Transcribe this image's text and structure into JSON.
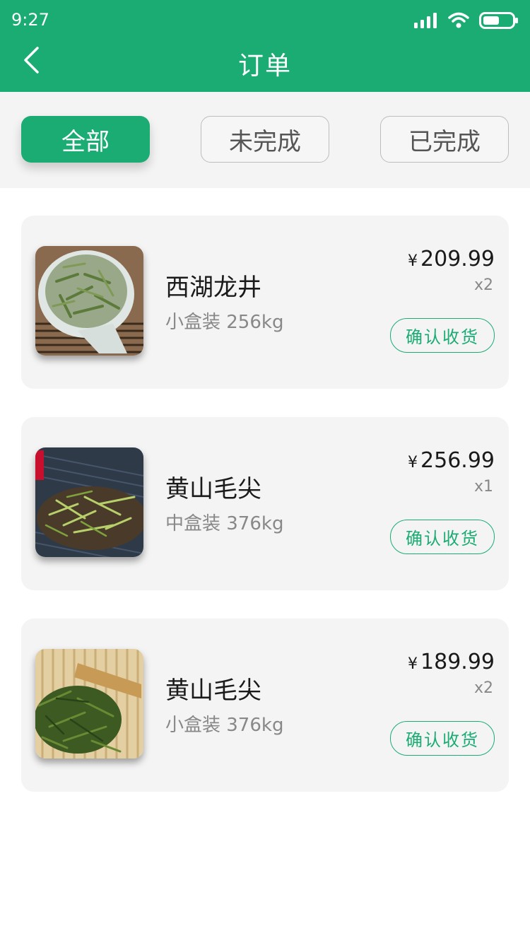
{
  "status_bar": {
    "time": "9:27"
  },
  "header": {
    "title": "订单"
  },
  "tabs": [
    {
      "label": "全部",
      "active": true
    },
    {
      "label": "未完成",
      "active": false
    },
    {
      "label": "已完成",
      "active": false
    }
  ],
  "orders": [
    {
      "name": "西湖龙井",
      "spec": "小盒装 256kg",
      "currency": "¥",
      "price": "209.99",
      "qty": "x2",
      "action": "确认收货"
    },
    {
      "name": "黄山毛尖",
      "spec": "中盒装 376kg",
      "currency": "¥",
      "price": "256.99",
      "qty": "x1",
      "action": "确认收货"
    },
    {
      "name": "黄山毛尖",
      "spec": "小盒装 376kg",
      "currency": "¥",
      "price": "189.99",
      "qty": "x2",
      "action": "确认收货"
    }
  ],
  "colors": {
    "brand_green": "#1aac73",
    "card_bg": "#f4f4f4"
  }
}
